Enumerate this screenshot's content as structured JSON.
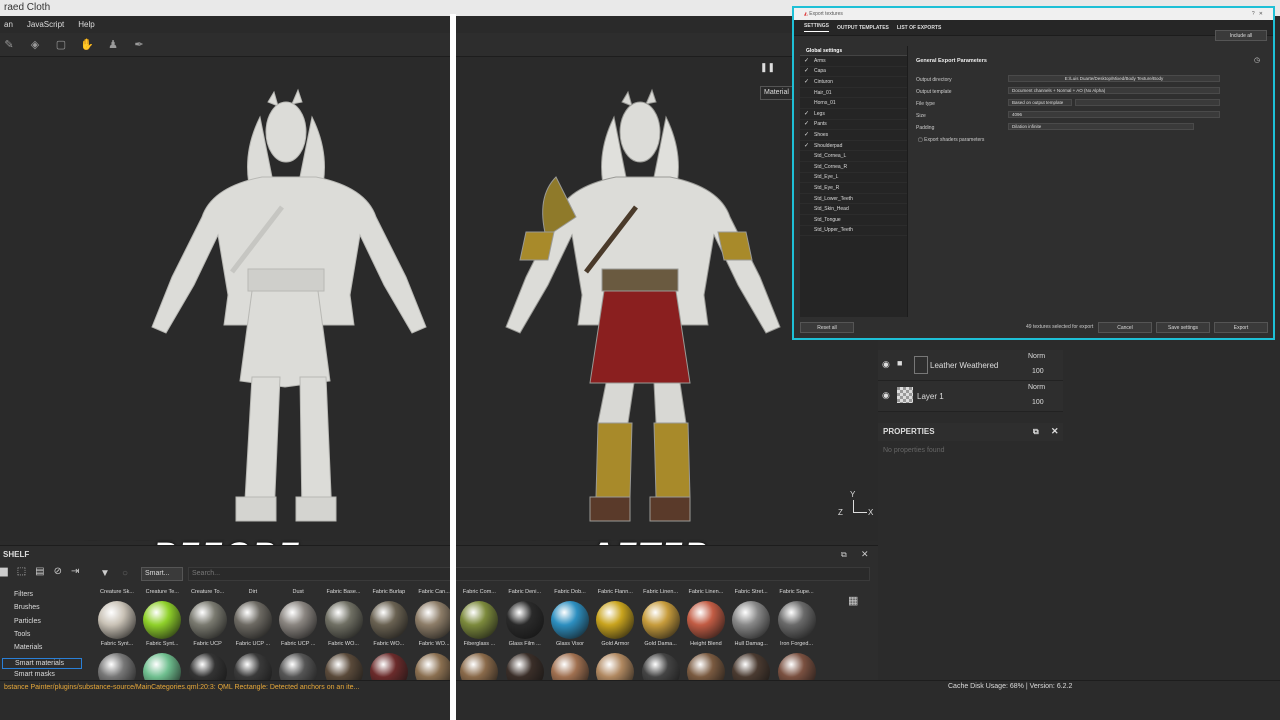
{
  "window": {
    "title": "raed Cloth"
  },
  "menu": [
    "an",
    "JavaScript",
    "Help"
  ],
  "labels": {
    "before": "BEFORE",
    "after": "AFTER"
  },
  "viewport": {
    "dropdown": "Material"
  },
  "export_dialog": {
    "title": "Export textures",
    "tabs": [
      "SETTINGS",
      "OUTPUT TEMPLATES",
      "LIST OF EXPORTS"
    ],
    "include_all": "Include all",
    "global_settings": "Global settings",
    "meshes": [
      {
        "name": "Arms",
        "checked": true
      },
      {
        "name": "Capa",
        "checked": true
      },
      {
        "name": "Cinturon",
        "checked": true
      },
      {
        "name": "Hair_01",
        "checked": false
      },
      {
        "name": "Horns_01",
        "checked": false
      },
      {
        "name": "Legs",
        "checked": true
      },
      {
        "name": "Pants",
        "checked": true
      },
      {
        "name": "Shoes",
        "checked": true
      },
      {
        "name": "Shoulderpad",
        "checked": true
      },
      {
        "name": "Std_Cornea_L",
        "checked": false
      },
      {
        "name": "Std_Cornea_R",
        "checked": false
      },
      {
        "name": "Std_Eye_L",
        "checked": false
      },
      {
        "name": "Std_Eye_R",
        "checked": false
      },
      {
        "name": "Std_Lower_Teeth",
        "checked": false
      },
      {
        "name": "Std_Skin_Head",
        "checked": false
      },
      {
        "name": "Std_Tongue",
        "checked": false
      },
      {
        "name": "Std_Upper_Teeth",
        "checked": false
      }
    ],
    "section_title": "General Export Parameters",
    "params": {
      "output_directory_label": "Output directory",
      "output_directory_value": "E:/Luis Duarte/Desktop/Mixed/Body Texture/Body",
      "output_template_label": "Output template",
      "output_template_value": "Document channels + Normal + AO (No Alpha)",
      "file_type_label": "File type",
      "file_type_value": "Based on output template",
      "size_label": "Size",
      "size_value": "4096",
      "padding_label": "Padding",
      "padding_value": "Dilation infinite",
      "export_shaders_label": "Export shaders parameters"
    },
    "footer": {
      "reset": "Reset all",
      "count": "49 textures selected for export",
      "cancel": "Cancel",
      "save": "Save settings",
      "export": "Export"
    }
  },
  "layers": [
    {
      "name": "Leather Weathered",
      "blend": "Norm",
      "opacity": "100"
    },
    {
      "name": "Layer 1",
      "blend": "Norm",
      "opacity": "100"
    }
  ],
  "properties": {
    "title": "PROPERTIES",
    "empty": "No properties found"
  },
  "shelf": {
    "title": "SHELF",
    "search_tag": "Smart...",
    "search_placeholder": "Search...",
    "categories": [
      "Filters",
      "Brushes",
      "Particles",
      "Tools",
      "Materials",
      "Smart materials",
      "Smart masks"
    ],
    "selected_category": "Smart materials",
    "row1_labels": [
      "Creature Sk...",
      "Creature Te...",
      "Creature To...",
      "Dirt",
      "Dust",
      "Fabric Base...",
      "Fabric Burlap",
      "Fabric Can...",
      "Fabric Com...",
      "Fabric Deni...",
      "Fabric Dob...",
      "Fabric Flann...",
      "Fabric Linen...",
      "Fabric Linen...",
      "Fabric Stret...",
      "Fabric Supe..."
    ],
    "row2_labels": [
      "Fabric Synt...",
      "Fabric Synt...",
      "Fabric UCP",
      "Fabric UCP ...",
      "Fabric UCP ...",
      "Fabric WO...",
      "Fabric WO...",
      "Fabric WO...",
      "Fiberglass ...",
      "Glass Film ...",
      "Glass Visor",
      "Gold Armor",
      "Gold Dama...",
      "Height Blend",
      "Hull Damag...",
      "Iron Forged..."
    ],
    "row1_colors": [
      "#c9c2b6",
      "#8fd12a",
      "#7a7a70",
      "#6d6a63",
      "#8a8580",
      "#707064",
      "#6a6252",
      "#8d7d68",
      "#7c8a3c",
      "#2a2a2a",
      "#2d8fc0",
      "#c9a41e",
      "#c79c3c",
      "#c25c44",
      "#888888",
      "#6a6a6a"
    ],
    "row2_colors": [
      "#777777",
      "#6fbf8f",
      "#333333",
      "#3a3a3a",
      "#555555",
      "#5a4a3a",
      "#6b2b2b",
      "#8a6f50",
      "#8a6a4a",
      "#3a2e28",
      "#a07050",
      "#b08860",
      "#444444",
      "#7a5a40",
      "#4a3a30",
      "#7a5040"
    ]
  },
  "status": {
    "message": "bstance Painter/plugins/substance-source/MainCategories.qml:20:3: QML Rectangle: Detected anchors on an ite...",
    "cache": "Cache Disk Usage:    68% | Version: 6.2.2"
  },
  "gizmo": {
    "y": "Y",
    "z": "Z",
    "x": "X"
  },
  "colors": {
    "accent": "#1ec0d6",
    "skirt": "#8a1f1f",
    "gold": "#a88a2a"
  }
}
